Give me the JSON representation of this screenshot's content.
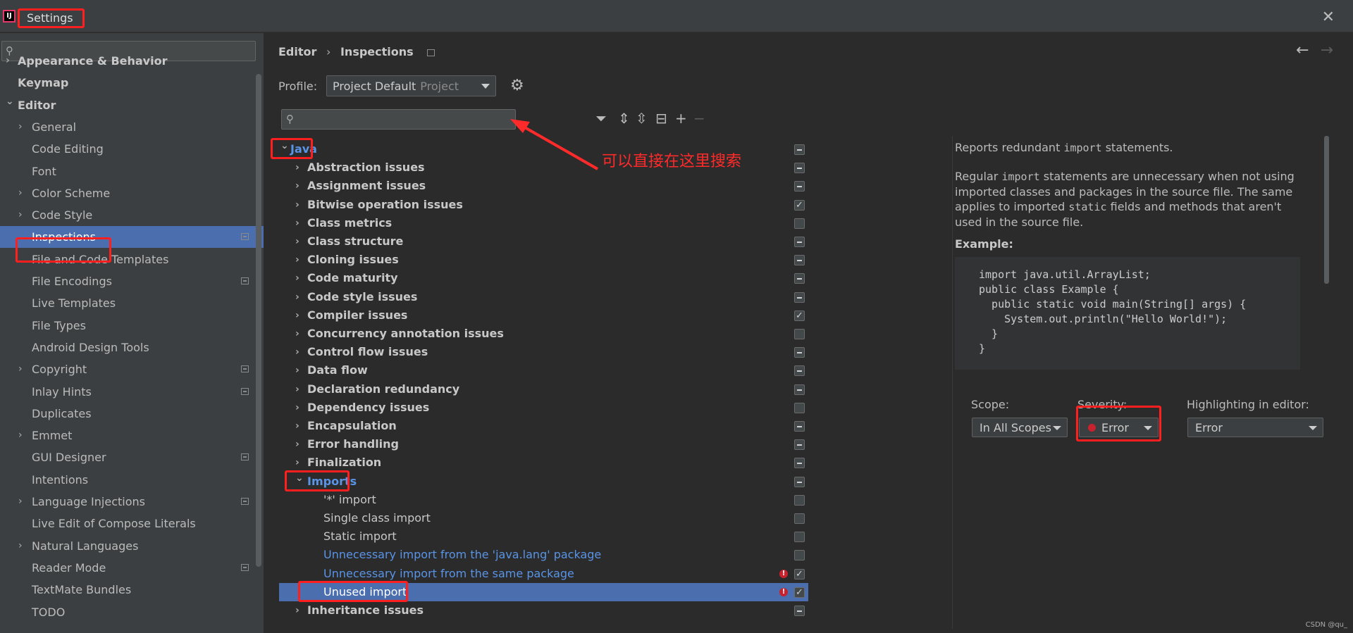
{
  "window": {
    "title": "Settings",
    "app_icon": "IJ"
  },
  "sidebar": {
    "search_placeholder": "",
    "items": [
      {
        "label": "Appearance & Behavior",
        "level": 0,
        "expandable": true,
        "expanded": false,
        "bold": true
      },
      {
        "label": "Keymap",
        "level": 0,
        "expandable": false,
        "bold": true
      },
      {
        "label": "Editor",
        "level": 0,
        "expandable": true,
        "expanded": true,
        "bold": true
      },
      {
        "label": "General",
        "level": 1,
        "expandable": true
      },
      {
        "label": "Code Editing",
        "level": 1
      },
      {
        "label": "Font",
        "level": 1
      },
      {
        "label": "Color Scheme",
        "level": 1,
        "expandable": true
      },
      {
        "label": "Code Style",
        "level": 1,
        "expandable": true
      },
      {
        "label": "Inspections",
        "level": 1,
        "selected": true,
        "marker": true
      },
      {
        "label": "File and Code Templates",
        "level": 1
      },
      {
        "label": "File Encodings",
        "level": 1,
        "marker": true
      },
      {
        "label": "Live Templates",
        "level": 1
      },
      {
        "label": "File Types",
        "level": 1
      },
      {
        "label": "Android Design Tools",
        "level": 1
      },
      {
        "label": "Copyright",
        "level": 1,
        "expandable": true,
        "marker": true
      },
      {
        "label": "Inlay Hints",
        "level": 1,
        "marker": true
      },
      {
        "label": "Duplicates",
        "level": 1
      },
      {
        "label": "Emmet",
        "level": 1,
        "expandable": true
      },
      {
        "label": "GUI Designer",
        "level": 1,
        "marker": true
      },
      {
        "label": "Intentions",
        "level": 1
      },
      {
        "label": "Language Injections",
        "level": 1,
        "expandable": true,
        "marker": true
      },
      {
        "label": "Live Edit of Compose Literals",
        "level": 1
      },
      {
        "label": "Natural Languages",
        "level": 1,
        "expandable": true
      },
      {
        "label": "Reader Mode",
        "level": 1,
        "marker": true
      },
      {
        "label": "TextMate Bundles",
        "level": 1
      },
      {
        "label": "TODO",
        "level": 1
      }
    ]
  },
  "breadcrumb": {
    "parent": "Editor",
    "separator": "›",
    "current": "Inspections"
  },
  "nav": {
    "back_icon": "arrow-left-icon",
    "forward_icon": "arrow-right-icon"
  },
  "profile": {
    "label": "Profile:",
    "value": "Project Default",
    "hint": "Project"
  },
  "inspection_search": {
    "placeholder": ""
  },
  "annotation": {
    "text": "可以直接在这里搜索",
    "color": "#ff2a2a"
  },
  "tree": [
    {
      "label": "Java",
      "type": "java",
      "indent": 0,
      "chev": "v",
      "check": "dash"
    },
    {
      "label": "Abstraction issues",
      "type": "bold",
      "indent": 1,
      "chev": ">",
      "check": "dash"
    },
    {
      "label": "Assignment issues",
      "type": "bold",
      "indent": 1,
      "chev": ">",
      "check": "dash"
    },
    {
      "label": "Bitwise operation issues",
      "type": "bold",
      "indent": 1,
      "chev": ">",
      "check": "checked"
    },
    {
      "label": "Class metrics",
      "type": "bold",
      "indent": 1,
      "chev": ">",
      "check": "empty"
    },
    {
      "label": "Class structure",
      "type": "bold",
      "indent": 1,
      "chev": ">",
      "check": "dash"
    },
    {
      "label": "Cloning issues",
      "type": "bold",
      "indent": 1,
      "chev": ">",
      "check": "dash"
    },
    {
      "label": "Code maturity",
      "type": "bold",
      "indent": 1,
      "chev": ">",
      "check": "dash"
    },
    {
      "label": "Code style issues",
      "type": "bold",
      "indent": 1,
      "chev": ">",
      "check": "dash"
    },
    {
      "label": "Compiler issues",
      "type": "bold",
      "indent": 1,
      "chev": ">",
      "check": "checked"
    },
    {
      "label": "Concurrency annotation issues",
      "type": "bold",
      "indent": 1,
      "chev": ">",
      "check": "empty"
    },
    {
      "label": "Control flow issues",
      "type": "bold",
      "indent": 1,
      "chev": ">",
      "check": "dash"
    },
    {
      "label": "Data flow",
      "type": "bold",
      "indent": 1,
      "chev": ">",
      "check": "dash"
    },
    {
      "label": "Declaration redundancy",
      "type": "bold",
      "indent": 1,
      "chev": ">",
      "check": "dash"
    },
    {
      "label": "Dependency issues",
      "type": "bold",
      "indent": 1,
      "chev": ">",
      "check": "empty"
    },
    {
      "label": "Encapsulation",
      "type": "bold",
      "indent": 1,
      "chev": ">",
      "check": "dash"
    },
    {
      "label": "Error handling",
      "type": "bold",
      "indent": 1,
      "chev": ">",
      "check": "dash"
    },
    {
      "label": "Finalization",
      "type": "bold",
      "indent": 1,
      "chev": ">",
      "check": "dash"
    },
    {
      "label": "Imports",
      "type": "java",
      "indent": 1,
      "chev": "v",
      "check": "dash"
    },
    {
      "label": "'*' import",
      "type": "normal",
      "indent": 2,
      "check": "empty"
    },
    {
      "label": "Single class import",
      "type": "normal",
      "indent": 2,
      "check": "empty"
    },
    {
      "label": "Static import",
      "type": "normal",
      "indent": 2,
      "check": "empty"
    },
    {
      "label": "Unnecessary import from the 'java.lang' package",
      "type": "link",
      "indent": 2,
      "check": "empty"
    },
    {
      "label": "Unnecessary import from the same package",
      "type": "link",
      "indent": 2,
      "check": "checked",
      "error": true
    },
    {
      "label": "Unused import",
      "type": "selected",
      "indent": 2,
      "check": "checked",
      "error": true
    },
    {
      "label": "Inheritance issues",
      "type": "bold",
      "indent": 1,
      "chev": ">",
      "check": "dash"
    }
  ],
  "description": {
    "p1_before": "Reports redundant ",
    "p1_code": "import",
    "p1_after": " statements.",
    "p2_a": "Regular ",
    "p2_code1": "import",
    "p2_b": " statements are unnecessary when not using imported classes and packages in the source file. The same applies to imported ",
    "p2_code2": "static",
    "p2_c": " fields and methods that aren't used in the source file.",
    "example_label": "Example:",
    "code": "import java.util.ArrayList;\npublic class Example {\n  public static void main(String[] args) {\n    System.out.println(\"Hello World!\");\n  }\n}"
  },
  "options": {
    "scope_label": "Scope:",
    "scope_value": "In All Scopes",
    "severity_label": "Severity:",
    "severity_value": "Error",
    "highlight_label": "Highlighting in editor:",
    "highlight_value": "Error"
  },
  "watermark": "CSDN @qu_"
}
